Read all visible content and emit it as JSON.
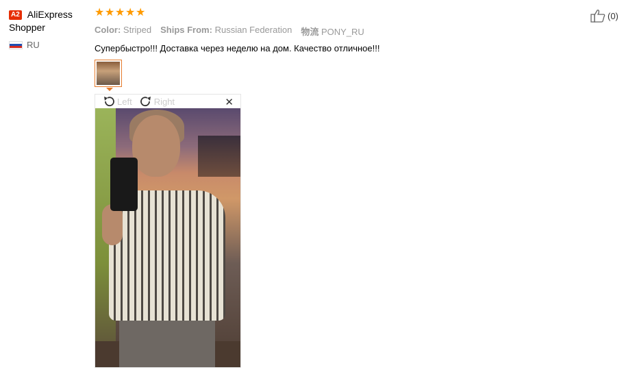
{
  "user": {
    "badge": "A2",
    "name_line1": "AliExpress",
    "name_line2": "Shopper",
    "country": "RU"
  },
  "review": {
    "stars": 5,
    "color_label": "Color:",
    "color_value": "Striped",
    "ships_label": "Ships From:",
    "ships_value": "Russian Federation",
    "logistics_label": "物流",
    "logistics_value": "PONY_RU",
    "text": "Супербыстро!!! Доставка через неделю на дом. Качество отличное!!!"
  },
  "viewer": {
    "rotate_left_label": "Left",
    "rotate_right_label": "Right",
    "close_symbol": "✕"
  },
  "helpful": {
    "count": "(0)"
  },
  "colors": {
    "star": "#ff9a00",
    "badge": "#e62e04",
    "thumb_border": "#e57b2c"
  }
}
